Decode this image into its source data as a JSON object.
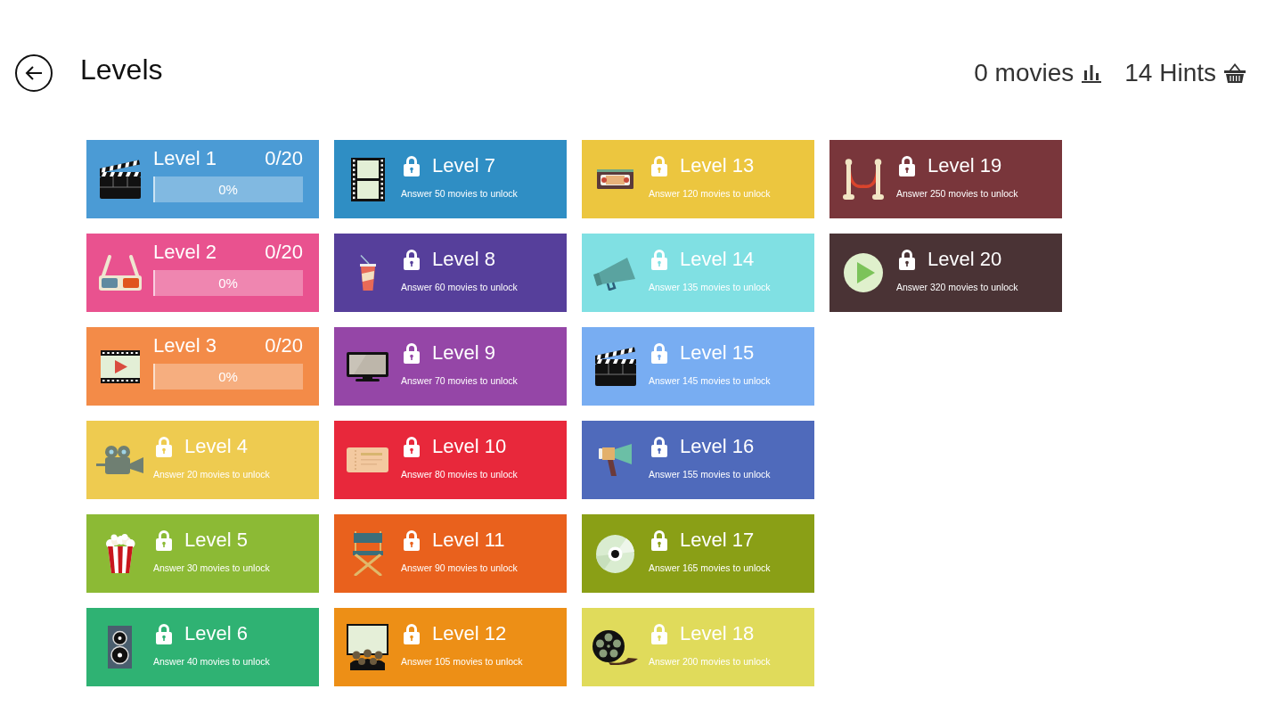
{
  "header": {
    "title": "Levels",
    "movies": "0 movies",
    "hints": "14 Hints"
  },
  "levels": [
    {
      "title": "Level 1",
      "locked": false,
      "score": "0/20",
      "percent": "0%",
      "level": 0,
      "color": "#4b9bd5"
    },
    {
      "title": "Level 2",
      "locked": false,
      "score": "0/20",
      "percent": "0%",
      "level": 0,
      "color": "#e9528f"
    },
    {
      "title": "Level 3",
      "locked": false,
      "score": "0/20",
      "percent": "0%",
      "level": 0,
      "color": "#f38b48"
    },
    {
      "title": "Level 4",
      "locked": true,
      "requirement": "Answer 20 movies to unlock",
      "color": "#eecb50"
    },
    {
      "title": "Level 5",
      "locked": true,
      "requirement": "Answer 30 movies to unlock",
      "color": "#8cba35"
    },
    {
      "title": "Level 6",
      "locked": true,
      "requirement": "Answer 40 movies to unlock",
      "color": "#2fb273"
    },
    {
      "title": "Level 7",
      "locked": true,
      "requirement": "Answer 50 movies to unlock",
      "color": "#2f8ec4"
    },
    {
      "title": "Level 8",
      "locked": true,
      "requirement": "Answer 60 movies to unlock",
      "color": "#563f9b"
    },
    {
      "title": "Level 9",
      "locked": true,
      "requirement": "Answer 70 movies to unlock",
      "color": "#9546a7"
    },
    {
      "title": "Level 10",
      "locked": true,
      "requirement": "Answer 80 movies to unlock",
      "color": "#e8283b"
    },
    {
      "title": "Level 11",
      "locked": true,
      "requirement": "Answer 90 movies to unlock",
      "color": "#e9611d"
    },
    {
      "title": "Level 12",
      "locked": true,
      "requirement": "Answer 105 movies to unlock",
      "color": "#ed8f16"
    },
    {
      "title": "Level 13",
      "locked": true,
      "requirement": "Answer 120 movies to unlock",
      "color": "#ecc63f"
    },
    {
      "title": "Level 14",
      "locked": true,
      "requirement": "Answer 135 movies to unlock",
      "color": "#80e0e3"
    },
    {
      "title": "Level 15",
      "locked": true,
      "requirement": "Answer 145 movies to unlock",
      "color": "#78adf2"
    },
    {
      "title": "Level 16",
      "locked": true,
      "requirement": "Answer 155 movies to unlock",
      "color": "#4f6abb"
    },
    {
      "title": "Level 17",
      "locked": true,
      "requirement": "Answer 165 movies to unlock",
      "color": "#8a9f16"
    },
    {
      "title": "Level 18",
      "locked": true,
      "requirement": "Answer 200 movies to unlock",
      "color": "#e0db5b"
    },
    {
      "title": "Level 19",
      "locked": true,
      "requirement": "Answer 250 movies to unlock",
      "color": "#79363b"
    },
    {
      "title": "Level 20",
      "locked": true,
      "requirement": "Answer 320 movies to unlock",
      "color": "#4a3335"
    }
  ]
}
